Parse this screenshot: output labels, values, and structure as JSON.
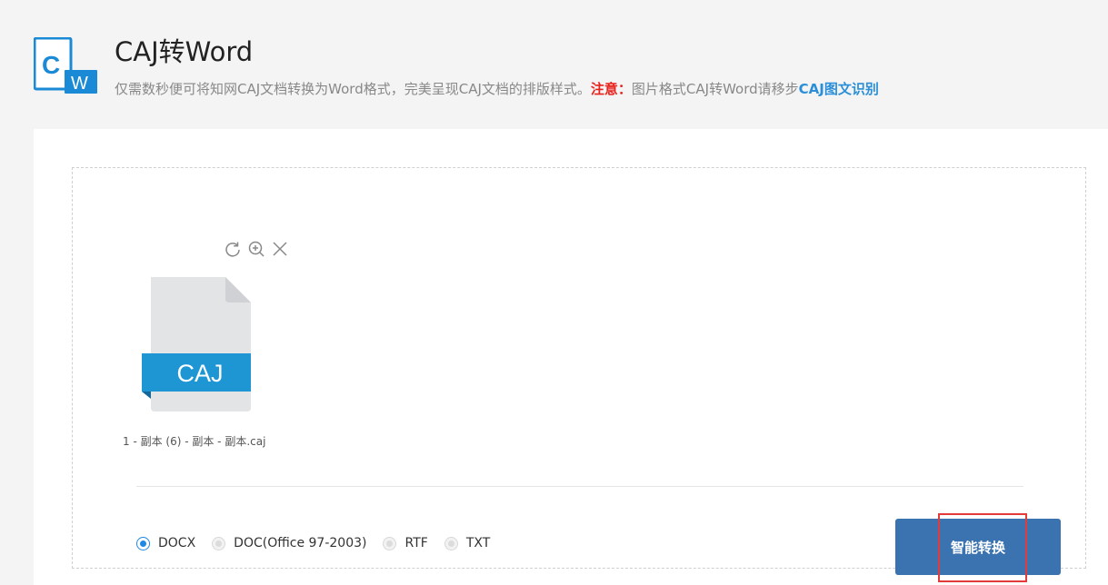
{
  "header": {
    "logo_letters": {
      "c": "C",
      "w": "W"
    },
    "title": "CAJ转Word",
    "subtitle_main": "仅需数秒便可将知网CAJ文档转换为Word格式，完美呈现CAJ文档的排版样式。",
    "note_label": "注意：",
    "note_text": "图片格式CAJ转Word请移步",
    "note_link": "CAJ图文识别",
    "colors": {
      "accent": "#2a8fd8",
      "note": "#e8231e"
    }
  },
  "file": {
    "type_label": "CAJ",
    "name": "1 - 副本 (6) - 副本 - 副本.caj",
    "tools": [
      "rotate-icon",
      "zoom-in-icon",
      "close-icon"
    ]
  },
  "formats": {
    "options": [
      {
        "label": "DOCX",
        "selected": true
      },
      {
        "label": "DOC(Office 97-2003)",
        "selected": false
      },
      {
        "label": "RTF",
        "selected": false
      },
      {
        "label": "TXT",
        "selected": false
      }
    ]
  },
  "actions": {
    "convert_label": "智能转换",
    "button_color": "#3b72b0",
    "highlight_color": "#e33b3b"
  }
}
